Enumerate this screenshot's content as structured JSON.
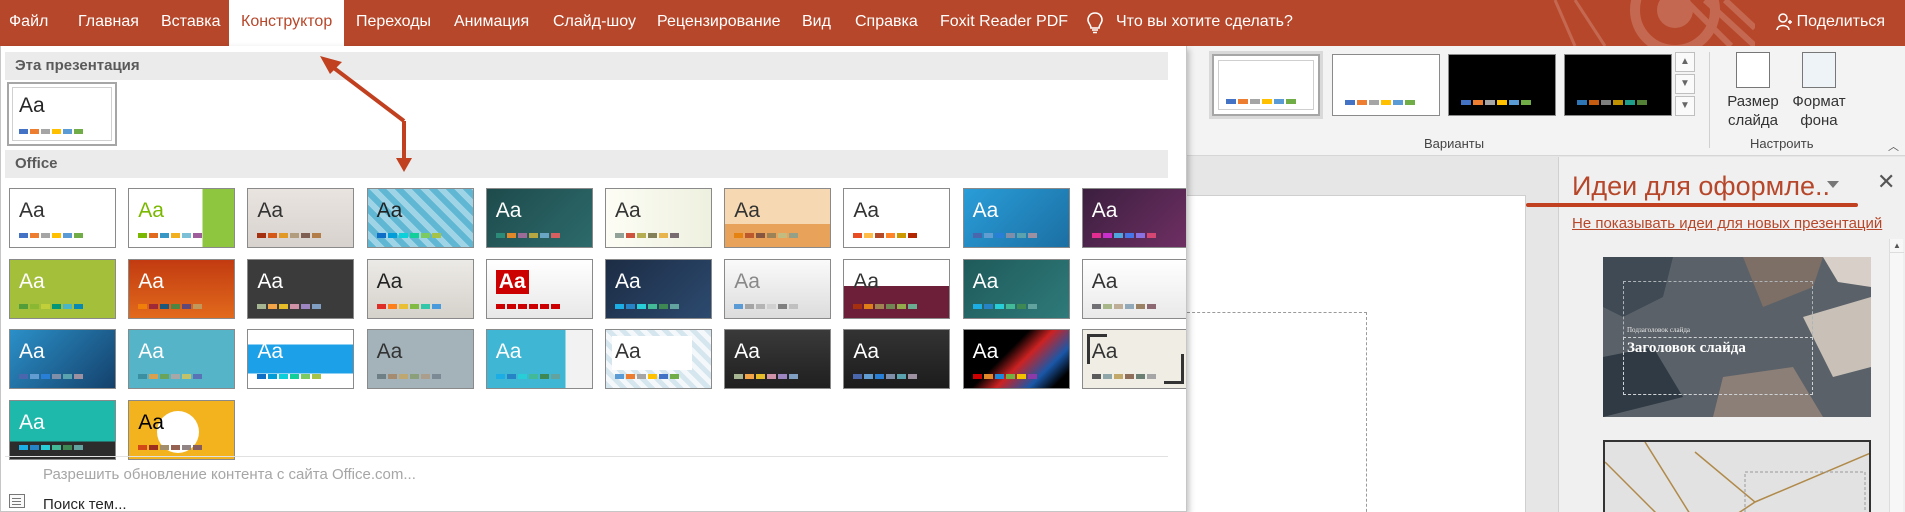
{
  "tabs": [
    {
      "label": "Файл"
    },
    {
      "label": "Главная"
    },
    {
      "label": "Вставка"
    },
    {
      "label": "Конструктор"
    },
    {
      "label": "Переходы"
    },
    {
      "label": "Анимация"
    },
    {
      "label": "Слайд-шоу"
    },
    {
      "label": "Рецензирование"
    },
    {
      "label": "Вид"
    },
    {
      "label": "Справка"
    },
    {
      "label": "Foxit Reader PDF"
    }
  ],
  "active_tab": "Конструктор",
  "tell_me": "Что вы хотите сделать?",
  "share": "Поделиться",
  "colors": {
    "accent": "#b7472a",
    "ribbon": "#f3f3f3",
    "annotation": "#c0401f"
  },
  "gallery": {
    "section_this": "Эта презентация",
    "section_office": "Office",
    "allow_update": "Разрешить обновление контента с сайта Office.com...",
    "search_themes": "Поиск тем...",
    "current_aa": "Aa",
    "themes": [
      {
        "aa": "Aa"
      },
      {
        "aa": "Aa"
      },
      {
        "aa": "Aa"
      },
      {
        "aa": "Aa"
      },
      {
        "aa": "Aa"
      },
      {
        "aa": "Aa"
      },
      {
        "aa": "Aa"
      },
      {
        "aa": "Aa"
      },
      {
        "aa": "Aa"
      },
      {
        "aa": "Aa"
      },
      {
        "aa": "Aa"
      },
      {
        "aa": "Aa"
      },
      {
        "aa": "Aa"
      },
      {
        "aa": "Aa"
      },
      {
        "aa": "Aa"
      },
      {
        "aa": "Aa"
      },
      {
        "aa": "Aa"
      },
      {
        "aa": "Aa"
      },
      {
        "aa": "Aa"
      },
      {
        "aa": "Aa"
      },
      {
        "aa": "Aa"
      },
      {
        "aa": "Aa"
      },
      {
        "aa": "Aa"
      },
      {
        "aa": "Aa"
      },
      {
        "aa": "Aa"
      },
      {
        "aa": "Aa"
      },
      {
        "aa": "Aa"
      },
      {
        "aa": "Aa"
      },
      {
        "aa": "Aa"
      },
      {
        "aa": "Aa"
      },
      {
        "aa": "Aa"
      },
      {
        "aa": "Aa"
      }
    ]
  },
  "ribbon": {
    "variants_label": "Варианты",
    "customize_label": "Настроить",
    "slide_size": "Размер слайда",
    "format_bg": "Формат фона"
  },
  "ideas": {
    "title": "Идеи для оформле..",
    "dont_show": "Не показывать идеи для новых презентаций",
    "idea1_subtitle": "Подзаголовок слайда",
    "idea1_title": "Заголовок слайда"
  }
}
